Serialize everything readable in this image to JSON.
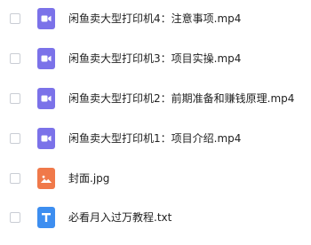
{
  "files": [
    {
      "name": "闲鱼卖大型打印机4：注意事项.mp4",
      "type": "video",
      "icon": "video-file-icon",
      "color": "#7b72e9"
    },
    {
      "name": "闲鱼卖大型打印机3：项目实操.mp4",
      "type": "video",
      "icon": "video-file-icon",
      "color": "#7b72e9"
    },
    {
      "name": "闲鱼卖大型打印机2：前期准备和赚钱原理.mp4",
      "type": "video",
      "icon": "video-file-icon",
      "color": "#7b72e9"
    },
    {
      "name": "闲鱼卖大型打印机1：项目介绍.mp4",
      "type": "video",
      "icon": "video-file-icon",
      "color": "#7b72e9"
    },
    {
      "name": "封面.jpg",
      "type": "image",
      "icon": "image-file-icon",
      "color": "#f0794a"
    },
    {
      "name": "必看月入过万教程.txt",
      "type": "text",
      "icon": "text-file-icon",
      "color": "#3d8ef0"
    }
  ]
}
